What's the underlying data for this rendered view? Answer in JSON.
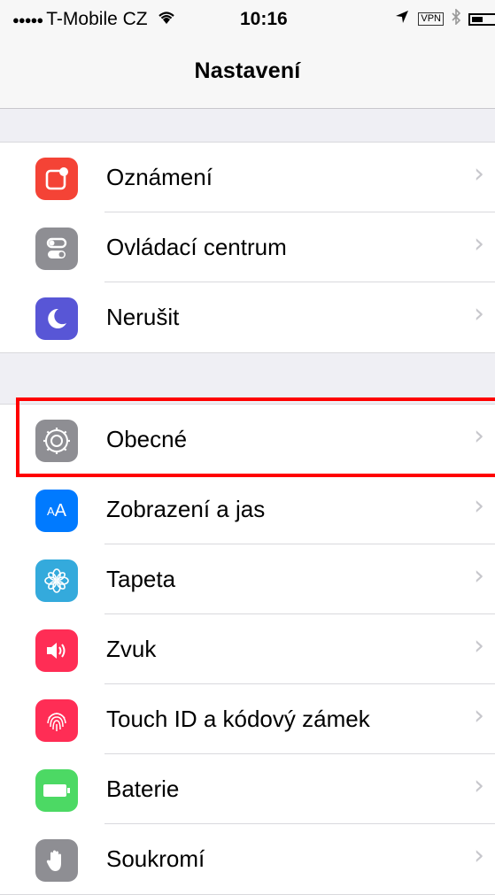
{
  "status_bar": {
    "signal": "●●●●●",
    "carrier": "T-Mobile CZ",
    "wifi_icon": "wifi-icon",
    "time": "10:16",
    "location_icon": "location-arrow-icon",
    "vpn": "VPN",
    "bluetooth_icon": "bluetooth-icon",
    "battery_icon": "battery-icon"
  },
  "nav": {
    "title": "Nastavení"
  },
  "groups": [
    [
      {
        "label": "Oznámení",
        "icon": "notifications-icon",
        "color": "#f44336"
      },
      {
        "label": "Ovládací centrum",
        "icon": "control-center-icon",
        "color": "#8e8e93"
      },
      {
        "label": "Nerušit",
        "icon": "moon-icon",
        "color": "#5856d6"
      }
    ],
    [
      {
        "label": "Obecné",
        "icon": "gear-icon",
        "color": "#8e8e93"
      },
      {
        "label": "Zobrazení a jas",
        "icon": "display-brightness-icon",
        "color": "#007aff"
      },
      {
        "label": "Tapeta",
        "icon": "wallpaper-icon",
        "color": "#34aadc"
      },
      {
        "label": "Zvuk",
        "icon": "sound-icon",
        "color": "#ff2d55"
      },
      {
        "label": "Touch ID a kódový zámek",
        "icon": "fingerprint-icon",
        "color": "#ff2d55"
      },
      {
        "label": "Baterie",
        "icon": "battery-icon",
        "color": "#4cd964"
      },
      {
        "label": "Soukromí",
        "icon": "hand-icon",
        "color": "#8e8e93"
      }
    ]
  ],
  "chevron": "›",
  "highlighted_item": "Obecné",
  "highlight_color": "#ff0000"
}
